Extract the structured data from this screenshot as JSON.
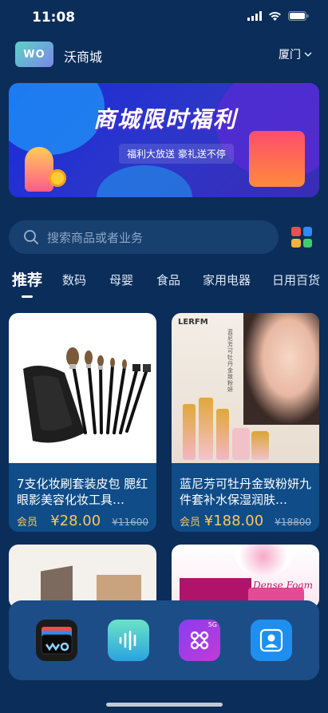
{
  "status_bar": {
    "time": "11:08"
  },
  "header": {
    "app_name": "沃商城",
    "city": "厦门",
    "logo_text": "WO"
  },
  "banner": {
    "title": "商城限时福利",
    "subtitle": "福利大放送 豪礼送不停"
  },
  "search": {
    "placeholder": "搜索商品或者业务"
  },
  "tabs": [
    {
      "label": "推荐"
    },
    {
      "label": "数码"
    },
    {
      "label": "母婴"
    },
    {
      "label": "食品"
    },
    {
      "label": "家用电器"
    },
    {
      "label": "日用百货"
    }
  ],
  "products": [
    {
      "name": "7支化妆刷套装皮包 腮红眼影美容化妆工具…",
      "price_label": "会员价",
      "price": "¥28.00",
      "original_price": "¥11600"
    },
    {
      "name": "蓝尼芳可牡丹金致粉妍九件套补水保湿润肤…",
      "price_label": "会员价",
      "price": "¥188.00",
      "original_price": "¥18800",
      "image_brand": "LERFM",
      "image_caption": "蓝尼芳可牡丹金致粉妍"
    },
    {
      "name": ""
    },
    {
      "name": "",
      "image_text": "Dense Foam"
    }
  ],
  "dock": [
    {
      "icon": "wo-wallet-icon"
    },
    {
      "icon": "voice-assistant-icon"
    },
    {
      "icon": "unicom-5g-icon",
      "badge": "5G"
    },
    {
      "icon": "contacts-icon"
    }
  ],
  "colors": {
    "background": "#0b2d59",
    "card": "#0f4c88",
    "price": "#f6c95a",
    "dock": "#1d4d86"
  }
}
